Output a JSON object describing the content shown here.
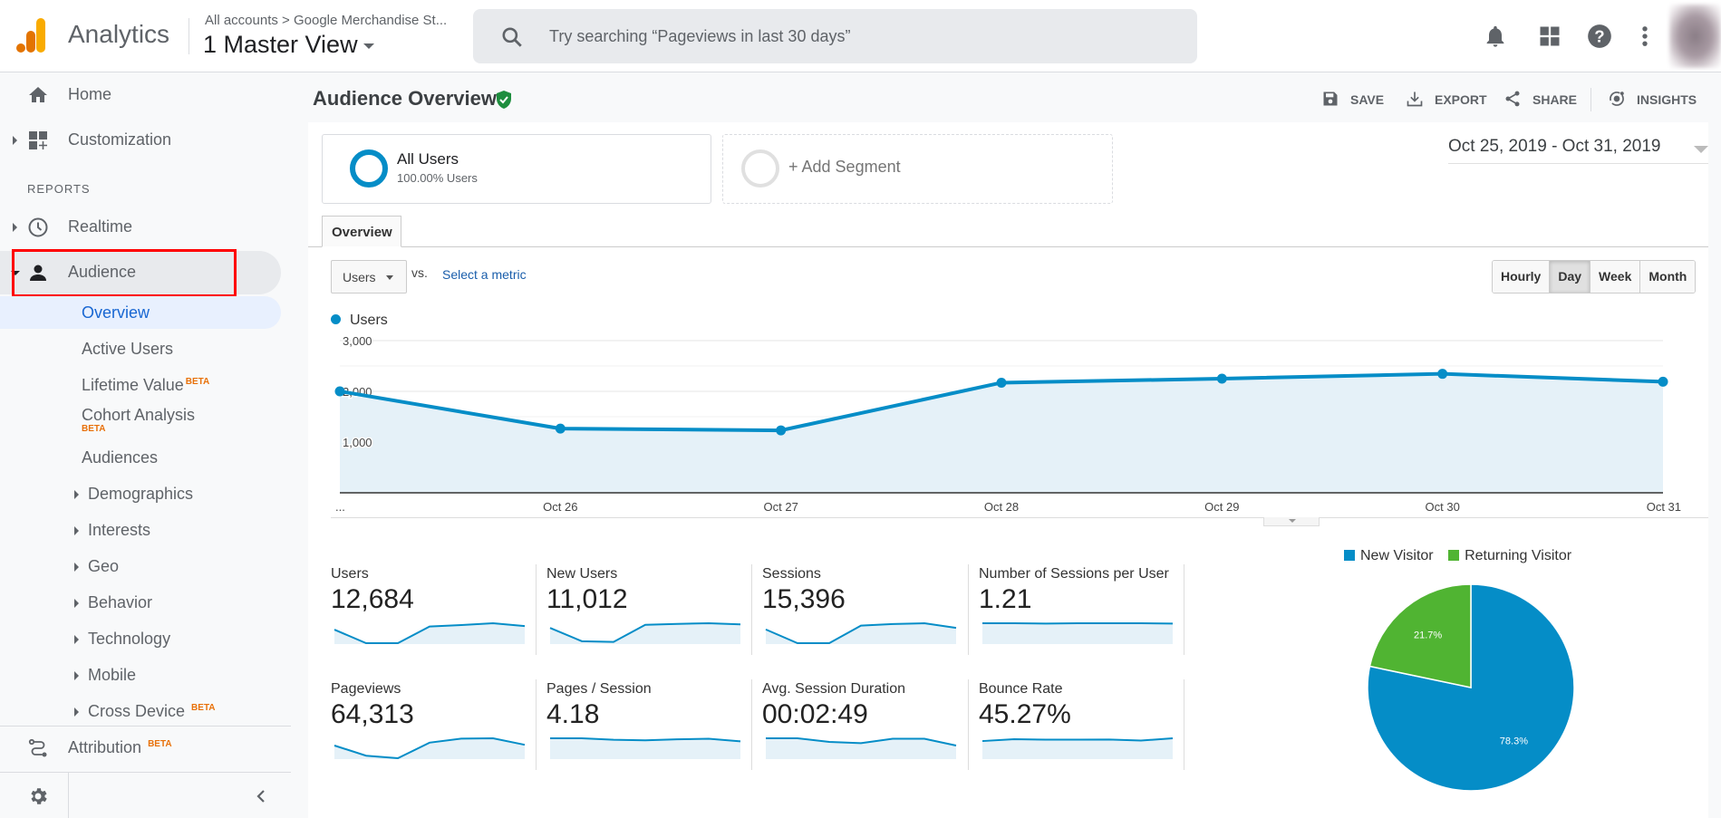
{
  "header": {
    "app_name": "Analytics",
    "breadcrumb": "All accounts > Google Merchandise St...",
    "view": "1 Master View",
    "search_placeholder": "Try searching “Pageviews in last 30 days”",
    "icons": [
      "notifications-icon",
      "apps-icon",
      "help-icon",
      "more-vert-icon",
      "avatar"
    ]
  },
  "sidebar": {
    "top_items": [
      {
        "label": "Home",
        "icon": "home-icon"
      },
      {
        "label": "Customization",
        "icon": "customization-icon"
      }
    ],
    "reports_label": "REPORTS",
    "report_items": [
      {
        "label": "Realtime",
        "icon": "clock-icon"
      },
      {
        "label": "Audience",
        "icon": "person-icon",
        "expanded": true,
        "highlighted": true
      }
    ],
    "audience_sub": [
      {
        "label": "Overview",
        "active": true
      },
      {
        "label": "Active Users"
      },
      {
        "label": "Lifetime Value",
        "badge": "BETA"
      },
      {
        "label": "Cohort Analysis",
        "badge": "BETA"
      },
      {
        "label": "Audiences"
      },
      {
        "label": "Demographics",
        "expandable": true
      },
      {
        "label": "Interests",
        "expandable": true
      },
      {
        "label": "Geo",
        "expandable": true
      },
      {
        "label": "Behavior",
        "expandable": true
      },
      {
        "label": "Technology",
        "expandable": true
      },
      {
        "label": "Mobile",
        "expandable": true
      },
      {
        "label": "Cross Device",
        "expandable": true,
        "badge": "BETA"
      }
    ],
    "attribution": {
      "label": "Attribution",
      "badge": "BETA"
    }
  },
  "page": {
    "title": "Audience Overview",
    "toolbar": {
      "save": "SAVE",
      "export": "EXPORT",
      "share": "SHARE",
      "insights": "INSIGHTS"
    },
    "segment": {
      "name": "All Users",
      "sub": "100.00% Users",
      "add_label": "+ Add Segment"
    },
    "date_range": "Oct 25, 2019 - Oct 31, 2019",
    "tab": "Overview",
    "metric_select": "Users",
    "vs_label": "vs.",
    "select_metric": "Select a metric",
    "granularity": [
      "Hourly",
      "Day",
      "Week",
      "Month"
    ],
    "granularity_active": "Day"
  },
  "colors": {
    "accent": "#058dc7",
    "fill": "#e5f1f8",
    "green": "#50b432",
    "highlight": "#ff0000"
  },
  "metrics": [
    {
      "name": "Users",
      "value": "12,684",
      "spark": [
        2000,
        1266,
        1231,
        2170,
        2250,
        2345,
        2190
      ]
    },
    {
      "name": "New Users",
      "value": "11,012",
      "spark": [
        1750,
        1150,
        1120,
        1890,
        1930,
        1960,
        1910
      ]
    },
    {
      "name": "Sessions",
      "value": "15,396",
      "spark": [
        2400,
        1500,
        1450,
        2650,
        2750,
        2800,
        2500
      ]
    },
    {
      "name": "Number of Sessions per User",
      "value": "1.21",
      "spark": [
        1.22,
        1.22,
        1.21,
        1.22,
        1.22,
        1.22,
        1.21
      ]
    },
    {
      "name": "Pageviews",
      "value": "64,313",
      "spark": [
        10000,
        7200,
        6500,
        10800,
        11900,
        12000,
        10200
      ]
    },
    {
      "name": "Pages / Session",
      "value": "4.18",
      "spark": [
        4.3,
        4.3,
        4.15,
        4.1,
        4.2,
        4.25,
        4.0
      ]
    },
    {
      "name": "Avg. Session Duration",
      "value": "00:02:49",
      "spark": [
        180,
        180,
        165,
        160,
        178,
        178,
        150
      ]
    },
    {
      "name": "Bounce Rate",
      "value": "45.27%",
      "spark": [
        44,
        46,
        45.5,
        45.5,
        45.6,
        44.5,
        47
      ]
    }
  ],
  "chart_data": [
    {
      "type": "area",
      "title": "",
      "legend": [
        "Users"
      ],
      "x": [
        "...",
        "Oct 26",
        "Oct 27",
        "Oct 28",
        "Oct 29",
        "Oct 30",
        "Oct 31"
      ],
      "series": [
        {
          "name": "Users",
          "values": [
            2000,
            1266,
            1231,
            2170,
            2250,
            2345,
            2190
          ]
        }
      ],
      "yticks": [
        "1,000",
        "2,000",
        "3,000"
      ],
      "ylim": [
        0,
        3000
      ],
      "grid": true
    },
    {
      "type": "pie",
      "legend": [
        "New Visitor",
        "Returning Visitor"
      ],
      "legend_position": "top",
      "values": [
        78.3,
        21.7
      ],
      "labels": [
        "78.3%",
        "21.7%"
      ],
      "colors": [
        "#058dc7",
        "#50b432"
      ]
    }
  ]
}
